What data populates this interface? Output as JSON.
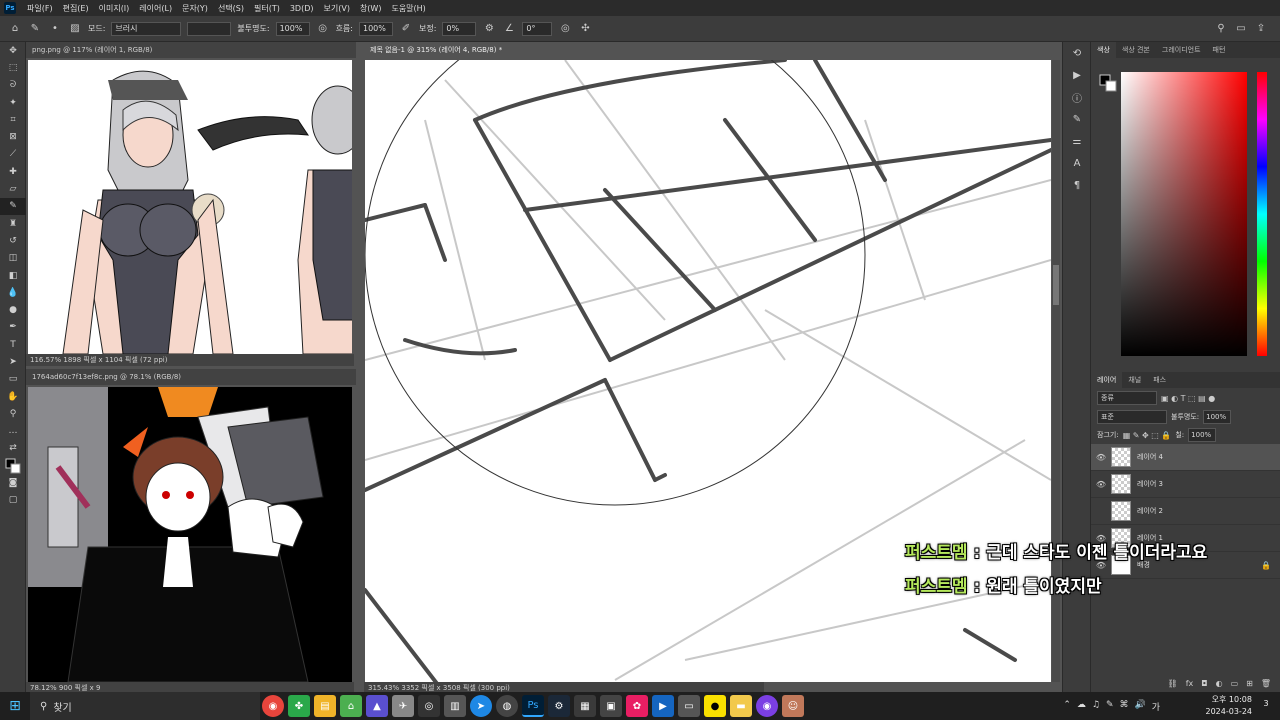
{
  "menu": [
    "파일(F)",
    "편집(E)",
    "이미지(I)",
    "레이어(L)",
    "문자(Y)",
    "선택(S)",
    "필터(T)",
    "3D(D)",
    "보기(V)",
    "창(W)",
    "도움말(H)"
  ],
  "options": {
    "mode_label": "모드:",
    "mode_value": "브러시",
    "opacity_label": "불투명도:",
    "opacity_value": "100%",
    "flow_label": "흐름:",
    "flow_value": "100%",
    "smooth_label": "보정:",
    "smooth_value": "0%",
    "angle_value": "0°"
  },
  "docs": {
    "doc1": {
      "tab": "png.png @ 117% (레이어 1, RGB/8)",
      "status": "116.57%    1898 픽셀 x 1104 픽셀 (72 ppi)"
    },
    "doc2": {
      "tab": "1764ad60c7f13ef8c.png @ 78.1% (RGB/8)",
      "status": "78.12%    900 픽셀 x 9"
    },
    "main": {
      "tab": "제목 없음-1 @ 315% (레이어 4, RGB/8) *",
      "status": "315.43%    3352 픽셀 x 3508 픽셀 (300 ppi)"
    }
  },
  "panel": {
    "tabs": [
      "색상",
      "색상 견본",
      "그레이디언트",
      "패턴"
    ],
    "layer_tabs": [
      "레이어",
      "채널",
      "패스"
    ],
    "kind_label": "종류",
    "blend_mode": "표준",
    "opacity_label": "불투명도:",
    "opacity_value": "100%",
    "lock_label": "잠그기:",
    "fill_label": "칠:",
    "fill_value": "100%",
    "layers": [
      {
        "name": "레이어 4",
        "visible": true,
        "selected": true
      },
      {
        "name": "레이어 3",
        "visible": true,
        "selected": false
      },
      {
        "name": "레이어 2",
        "visible": false,
        "selected": false
      },
      {
        "name": "레이어 1",
        "visible": true,
        "selected": false
      },
      {
        "name": "배경",
        "visible": true,
        "selected": false,
        "locked": true
      }
    ]
  },
  "chat": [
    {
      "nick": "퍼스트멤",
      "msg": "근데 스타도 이젠 틀이더라고요"
    },
    {
      "nick": "퍼스트멤",
      "msg": "원래 틀이였지만"
    }
  ],
  "taskbar": {
    "search": "찾기",
    "time": "오후 10:08",
    "date": "2024-03-24",
    "badge": "3"
  }
}
